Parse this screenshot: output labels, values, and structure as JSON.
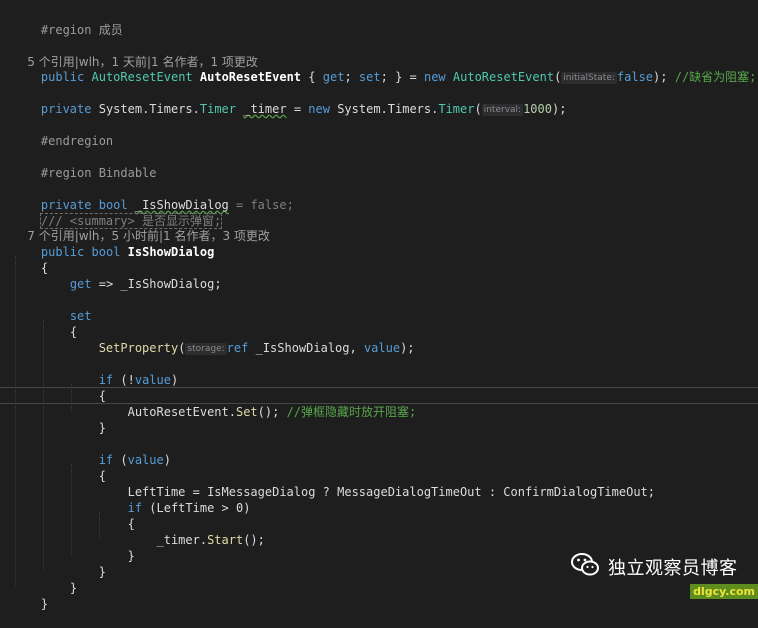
{
  "code": {
    "l1": {
      "kw": "#region",
      "text": " 成员"
    },
    "l2": {
      "lens": "5 个引用|wlh，1 天前|1 名作者，1 项更改"
    },
    "l3": {
      "kw1": "public",
      "type1": "AutoResetEvent",
      "name": "AutoResetEvent",
      "acc1": "{",
      "get": "get",
      "semi1": ";",
      "set": "set",
      "semi2": ";",
      "acc2": "} =",
      "new": "new",
      "type2": "AutoResetEvent",
      "open": "(",
      "hint": "initialState:",
      "false": "false",
      "close": ");",
      "comment": "//缺省为阻塞;"
    },
    "l4": {
      "kw": "private",
      "ns": "System.Timers.",
      "type": "Timer",
      "name": "_timer",
      "eq": " = ",
      "new": "new",
      "ns2": "System.Timers.",
      "type2": "Timer",
      "open": "(",
      "hint": "interval:",
      "num": "1000",
      "close": ");"
    },
    "l5": {
      "kw": "#endregion"
    },
    "l6": {
      "kw": "#region",
      "text": " Bindable"
    },
    "l7": {
      "kw1": "private",
      "kw2": "bool",
      "name": "_IsShowDialog",
      "rest": " = false;"
    },
    "l8": {
      "comment": "/// <summary> 是否显示弹窗;"
    },
    "l9": {
      "lens": "7 个引用|wlh，5 小时前|1 名作者，3 项更改"
    },
    "l10": {
      "kw1": "public",
      "kw2": "bool",
      "name": "IsShowDialog"
    },
    "l11": {
      "text": "{"
    },
    "l12": {
      "kw": "get",
      "text": " => _IsShowDialog;"
    },
    "l13": {
      "kw": "set"
    },
    "l14": {
      "text": "{"
    },
    "l15": {
      "method": "SetProperty",
      "open": "(",
      "hint": "storage:",
      "kw": "ref",
      "text": " _IsShowDialog, ",
      "val": "value",
      "close": ");"
    },
    "l16": {
      "kw": "if",
      "text": " (!",
      "val": "value",
      "close": ")"
    },
    "l17": {
      "text": "{"
    },
    "l18": {
      "text": "AutoResetEvent.",
      "method": "Set",
      "close": "(); ",
      "comment": "//弹框隐藏时放开阻塞;"
    },
    "l19": {
      "text": "}"
    },
    "l20": {
      "kw": "if",
      "text": " (",
      "val": "value",
      "close": ")"
    },
    "l21": {
      "text": "{"
    },
    "l22": {
      "text": "LeftTime = IsMessageDialog ? MessageDialogTimeOut : ConfirmDialogTimeOut;"
    },
    "l23": {
      "kw": "if",
      "text": " (LeftTime > 0)"
    },
    "l24": {
      "text": "{"
    },
    "l25": {
      "text": "_timer.",
      "method": "Start",
      "close": "();"
    },
    "l26": {
      "text": "}"
    },
    "l27": {
      "text": "}"
    },
    "l28": {
      "text": "}"
    },
    "l29": {
      "text": "}"
    }
  },
  "watermark": {
    "icon": "wechat-icon",
    "text": "独立观察员博客",
    "site": "dlgcy.com"
  },
  "colors": {
    "background": "#1e1e1e",
    "keyword": "#569cd6",
    "type": "#4ec9b0",
    "comment": "#57a64a",
    "number": "#b5cea8"
  }
}
